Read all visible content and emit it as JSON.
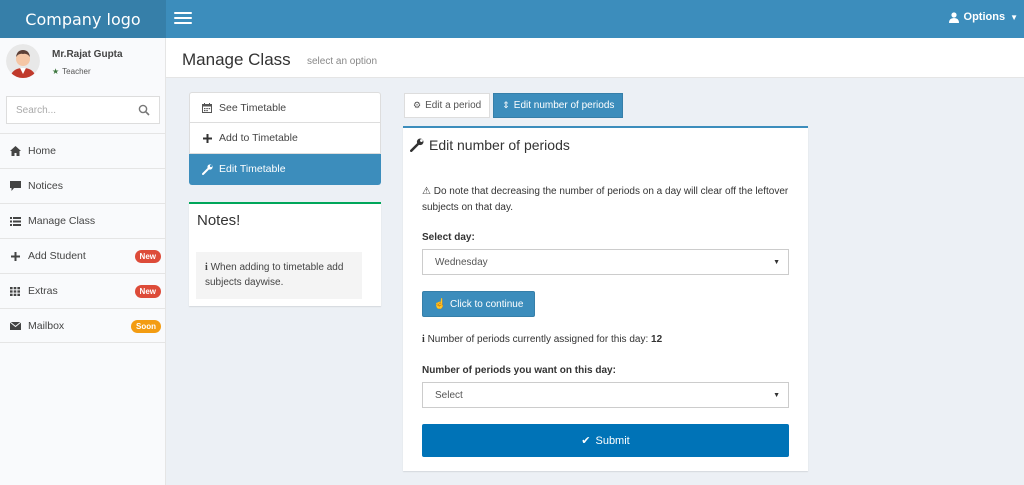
{
  "header": {
    "logo": "Company logo",
    "options_label": "Options"
  },
  "user": {
    "name": "Mr.Rajat Gupta",
    "role": "Teacher"
  },
  "search": {
    "placeholder": "Search..."
  },
  "sidebar": {
    "items": [
      {
        "label": "Home",
        "icon": "home-icon"
      },
      {
        "label": "Notices",
        "icon": "comment-icon"
      },
      {
        "label": "Manage Class",
        "icon": "list-icon"
      },
      {
        "label": "Add Student",
        "icon": "plus-icon",
        "badge": "New",
        "badge_color": "#dd4b39"
      },
      {
        "label": "Extras",
        "icon": "grid-icon",
        "badge": "New",
        "badge_color": "#dd4b39"
      },
      {
        "label": "Mailbox",
        "icon": "envelope-icon",
        "badge": "Soon",
        "badge_color": "#f39c12"
      }
    ]
  },
  "page": {
    "title": "Manage Class",
    "subtitle": "select an option"
  },
  "leftnav": {
    "items": [
      {
        "label": "See Timetable",
        "icon": "calendar-icon"
      },
      {
        "label": "Add to Timetable",
        "icon": "plus-icon"
      },
      {
        "label": "Edit Timetable",
        "icon": "wrench-icon",
        "active": true
      }
    ]
  },
  "notes": {
    "title": "Notes!",
    "text": "When adding to timetable add subjects daywise."
  },
  "tabs": [
    {
      "label": "Edit a period",
      "icon": "gear-icon"
    },
    {
      "label": "Edit number of periods",
      "icon": "sort-icon",
      "active": true
    }
  ],
  "form": {
    "title": "Edit number of periods",
    "warning": "Do note that decreasing the number of periods on a day will clear off the leftover subjects on that day.",
    "select_day_label": "Select day:",
    "select_day_value": "Wednesday",
    "continue_label": "Click to continue",
    "assigned_prefix": "Number of periods currently assigned for this day:",
    "assigned_value": "12",
    "periods_label": "Number of periods you want on this day:",
    "periods_value": "Select",
    "submit_label": "Submit"
  },
  "colors": {
    "primary": "#3c8dbc",
    "submit": "#0073b7",
    "notes_accent": "#00a65a"
  }
}
